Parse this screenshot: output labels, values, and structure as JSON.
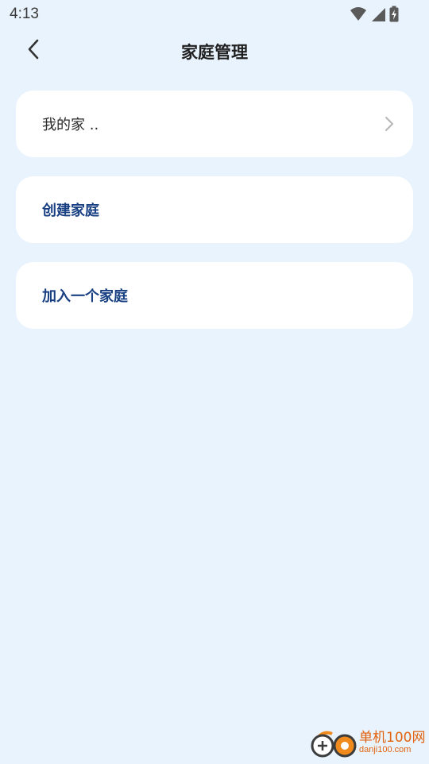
{
  "status_bar": {
    "time": "4:13",
    "icons": [
      "wifi-icon",
      "cellular-signal-icon",
      "battery-charging-icon"
    ]
  },
  "header": {
    "title": "家庭管理",
    "back_icon": "chevron-left-icon"
  },
  "menu": {
    "items": [
      {
        "label": "我的家 ..",
        "style": "regular",
        "has_chevron": true
      },
      {
        "label": "创建家庭",
        "style": "action",
        "has_chevron": false
      },
      {
        "label": "加入一个家庭",
        "style": "action",
        "has_chevron": false
      }
    ]
  },
  "watermark": {
    "site_name": "单机100网",
    "url": "danji100.com"
  },
  "colors": {
    "background": "#e9f3fd",
    "card": "#ffffff",
    "action_text": "#173f82",
    "watermark": "#e2630f"
  }
}
